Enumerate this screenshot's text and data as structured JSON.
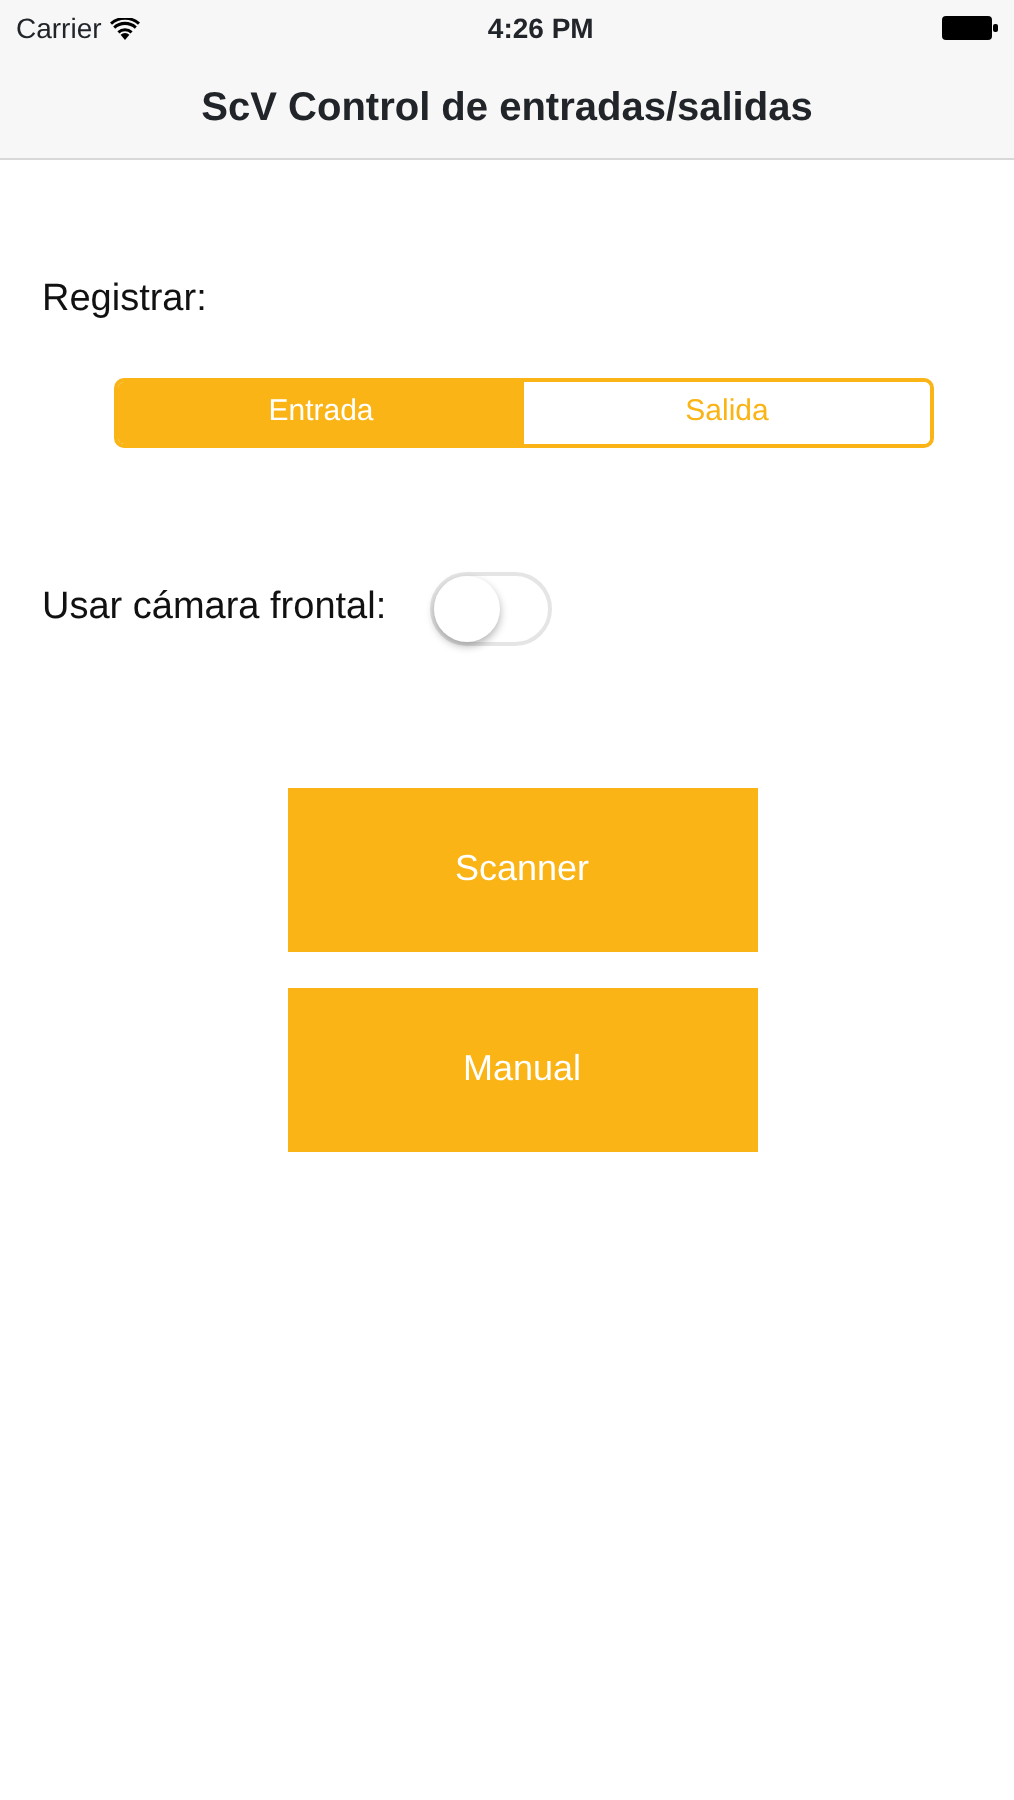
{
  "status_bar": {
    "carrier": "Carrier",
    "time": "4:26 PM"
  },
  "nav_bar": {
    "title": "ScV Control de entradas/salidas"
  },
  "register": {
    "label": "Registrar:",
    "segments": [
      {
        "label": "Entrada",
        "selected": true
      },
      {
        "label": "Salida",
        "selected": false
      }
    ]
  },
  "front_camera": {
    "label": "Usar cámara frontal:",
    "on": false
  },
  "buttons": [
    "Scanner",
    "Manual"
  ]
}
